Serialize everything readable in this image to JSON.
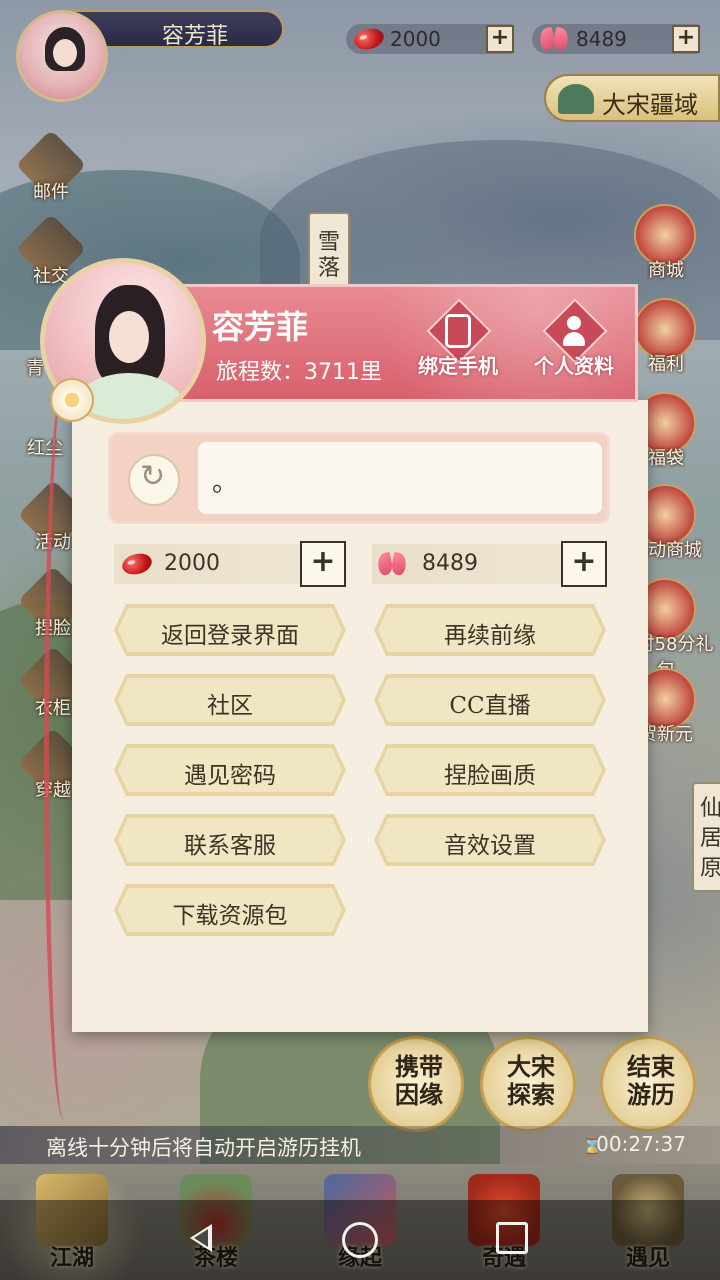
{
  "topbar": {
    "player_name": "容芳菲",
    "beans": "2000",
    "butterflies": "8489",
    "plus": "+",
    "region_button": "大宋疆域"
  },
  "left_icons": [
    {
      "label": "邮件"
    },
    {
      "label": "社交"
    },
    {
      "label": "青"
    },
    {
      "label": "红尘"
    },
    {
      "label": "活动"
    },
    {
      "label": "捏脸"
    },
    {
      "label": "衣柜"
    },
    {
      "label": "穿越"
    }
  ],
  "right_icons": [
    {
      "label": "商城"
    },
    {
      "label": "福利"
    },
    {
      "label": "福袋"
    },
    {
      "label": "活动商城"
    },
    {
      "label": "小时58分礼包"
    },
    {
      "label": "贺新元"
    }
  ],
  "map_tags": {
    "snow": "雪落",
    "immortal": "仙居原"
  },
  "profile": {
    "name": "容芳菲",
    "journey": "旅程数：3711里",
    "bind_phone": "绑定手机",
    "personal_info": "个人资料",
    "signature": "。",
    "beans": "2000",
    "butterflies": "8489",
    "plus": "+"
  },
  "menu": [
    {
      "label": "返回登录界面"
    },
    {
      "label": "再续前缘"
    },
    {
      "label": "社区"
    },
    {
      "label": "CC直播"
    },
    {
      "label": "遇见密码"
    },
    {
      "label": "捏脸画质"
    },
    {
      "label": "联系客服"
    },
    {
      "label": "音效设置"
    },
    {
      "label": "下载资源包"
    }
  ],
  "actions": [
    {
      "label": "携带因缘"
    },
    {
      "label": "大宋探索"
    },
    {
      "label": "结束游历"
    }
  ],
  "idle_tip": "离线十分钟后将自动开启游历挂机",
  "timer": "00:27:37",
  "hourglass": "⌛",
  "bottom_nav": [
    {
      "label": "江湖"
    },
    {
      "label": "茶楼"
    },
    {
      "label": "缘起"
    },
    {
      "label": "奇遇"
    },
    {
      "label": "遇见"
    }
  ],
  "colors": {
    "dialog_bg": "#f6efe1",
    "header_pink": "#d8606c",
    "button_gold": "#e6d5a3"
  }
}
